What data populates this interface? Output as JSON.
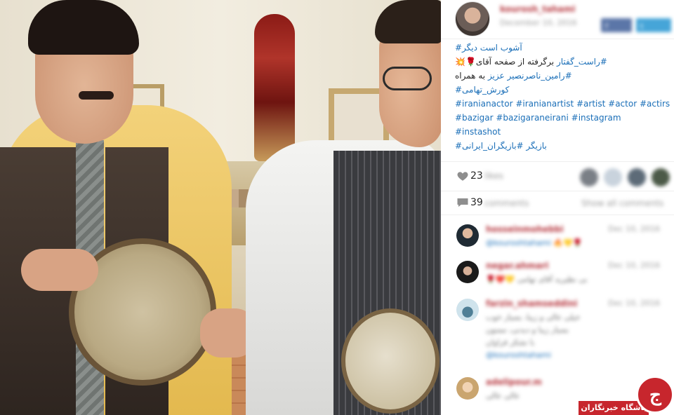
{
  "post": {
    "username": "kourosh_tahami",
    "date": "December 10, 2016",
    "share_buttons": {
      "facebook": "f",
      "twitter": "t"
    }
  },
  "caption": {
    "line1": "آشوب است دیگر#",
    "line2_emoji": "🌹💥",
    "line2_text": "برگرفته از صفحه آقای",
    "line2_tag": "#راست_گفتار",
    "line3_text": "به همراه",
    "line3_tag": "#رامین_ناصرنصیر عزیز",
    "line4": "کورش_تهامی#",
    "line5": "#iranianactor #iranianartist #artist #actor #actirs",
    "line6": "#bazigar #bazigaraneirani #instagram",
    "line7": "#instashot",
    "line8": "بازیگر #بازیگران_ایرانی#"
  },
  "likes": {
    "count": "23",
    "label": "likes"
  },
  "comments": {
    "count": "39",
    "label": "comments",
    "show_all": "Show all comments"
  },
  "comment_list": [
    {
      "user": "hosseinmohebbi",
      "time": "Dec 10, 2016",
      "text": "@kouroshtahami",
      "avatar_color": "#4a6d8c"
    },
    {
      "user": "negar.ahmari",
      "time": "Dec 10, 2016",
      "text": "بی نظیرید آقای تهامی",
      "avatar_color": "#2c2c2c"
    },
    {
      "user": "farzin_shamseddini",
      "time": "Dec 10, 2016",
      "text": "@kouroshtahami",
      "avatar_color": "#86b7d3"
    },
    {
      "user": "adelipour.m",
      "time": "Dec 10, 2016",
      "text": "عالی عالی",
      "avatar_color": "#d7a884"
    }
  ],
  "watermark": {
    "name": "باشگاه خبرنگاران",
    "glyph": "ج"
  },
  "colors": {
    "link": "#1b6fb8",
    "username": "#b6363e",
    "muted": "#9a9a9a",
    "brand_red": "#c7262d"
  },
  "icons": {
    "heart": "heart-icon",
    "comment": "comment-icon"
  }
}
